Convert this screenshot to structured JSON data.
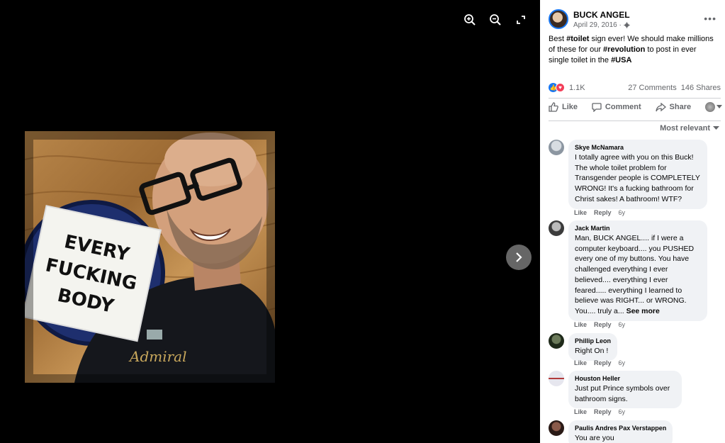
{
  "viewer": {
    "tools": [
      "zoom-in",
      "zoom-out",
      "fullscreen"
    ],
    "sign_lines": [
      "EVERY",
      "FUCKING",
      "BODY"
    ],
    "shirt_text": "Admiral"
  },
  "post": {
    "author": "BUCK ANGEL",
    "date": "April 29, 2016 ·",
    "text_parts": {
      "p1": "Best ",
      "h1": "#toilet",
      "p2": " sign ever! We should make millions of these for our ",
      "h2": "#revolution",
      "p3": " to post in ever single toilet in the ",
      "h3": "#USA"
    },
    "reactions_count": "1.1K",
    "comments_count": "27 Comments",
    "shares_count": "146 Shares",
    "actions": {
      "like": "Like",
      "comment": "Comment",
      "share": "Share"
    },
    "sort_label": "Most relevant"
  },
  "comments": [
    {
      "name": "Skye McNamara",
      "text": "I totally agree with you on this Buck! The whole toilet problem for Transgender people is COMPLETELY WRONG! It's a fucking bathroom for Christ sakes! A bathroom! WTF?",
      "see_more": "",
      "like": "Like",
      "reply": "Reply",
      "age": "6y",
      "avatar_color": "#9aa3ad"
    },
    {
      "name": "Jack Martin",
      "text": "Man, BUCK ANGEL.... if I were a computer keyboard.... you PUSHED every one of my buttons. You have challenged everything I ever believed.... everything I ever feared..... everything I learned to believe was RIGHT... or WRONG. You.... truly a...",
      "see_more": "See more",
      "like": "Like",
      "reply": "Reply",
      "age": "6y",
      "avatar_color": "#555555"
    },
    {
      "name": "Phillip Leon",
      "text": "Right On !",
      "see_more": "",
      "like": "Like",
      "reply": "Reply",
      "age": "6y",
      "avatar_color": "#2e3a2a"
    },
    {
      "name": "Houston Heller",
      "text": "Just put Prince symbols over bathroom signs.",
      "see_more": "",
      "like": "Like",
      "reply": "Reply",
      "age": "6y",
      "avatar_color": "#c9c9d6"
    },
    {
      "name": "Paulis Andres Pax Verstappen",
      "text": "You are you",
      "see_more": "",
      "like": "",
      "reply": "",
      "age": "",
      "avatar_color": "#3b2a26"
    }
  ],
  "colors": {
    "link_blue": "#1877f2",
    "muted": "#65676b",
    "bubble": "#f0f2f5"
  }
}
